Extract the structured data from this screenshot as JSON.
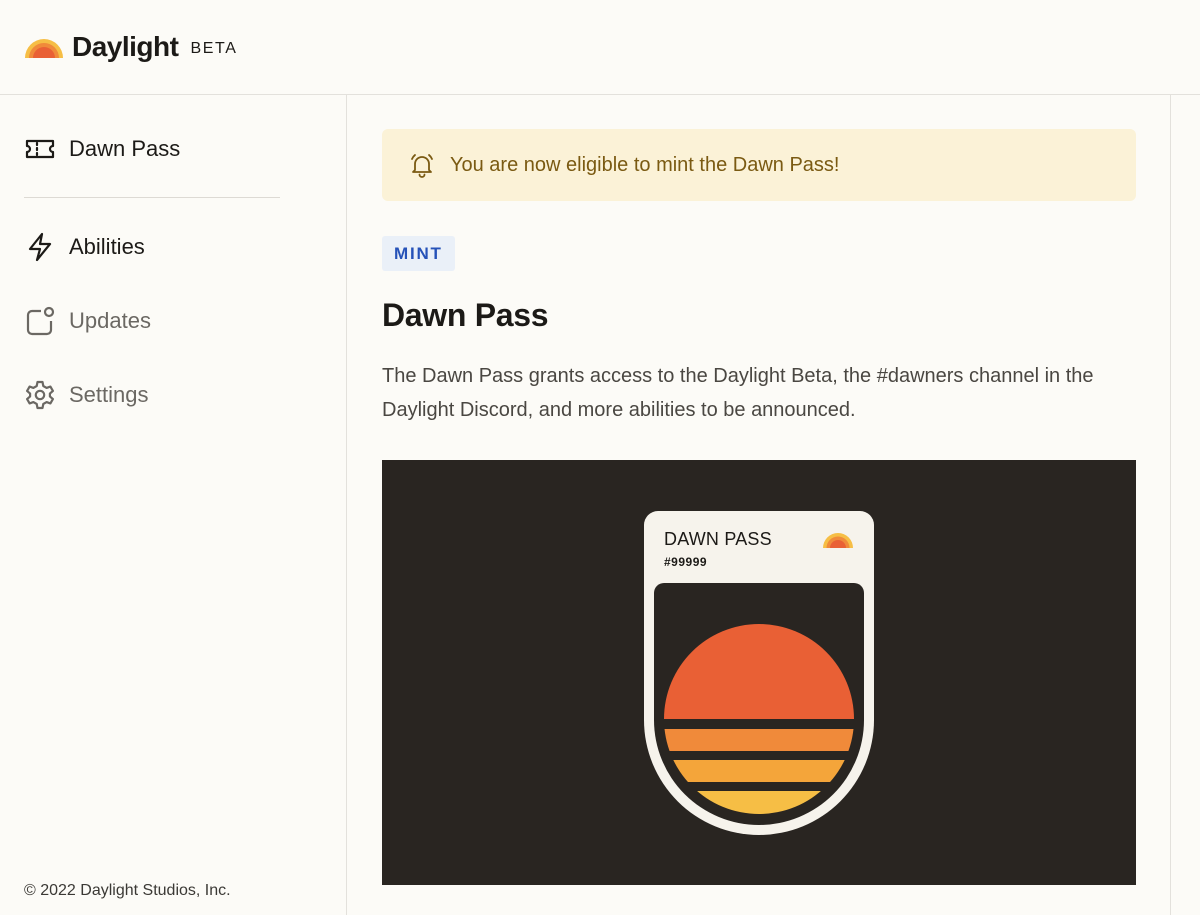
{
  "header": {
    "brand": "Daylight",
    "badge": "BETA",
    "logo_icon": "sunrise-logo-icon"
  },
  "sidebar": {
    "items": [
      {
        "label": "Dawn Pass",
        "icon": "ticket-icon",
        "state": "active"
      },
      {
        "label": "Abilities",
        "icon": "lightning-icon",
        "state": "default"
      },
      {
        "label": "Updates",
        "icon": "notification-square-icon",
        "state": "muted"
      },
      {
        "label": "Settings",
        "icon": "gear-icon",
        "state": "muted"
      }
    ],
    "footer": "© 2022 Daylight Studios, Inc."
  },
  "main": {
    "banner": {
      "text": "You are now eligible to mint the Dawn Pass!",
      "icon": "bell-icon"
    },
    "tag": "MINT",
    "title": "Dawn Pass",
    "description": "The Dawn Pass grants access to the Daylight Beta, the #dawners channel in the Daylight Discord, and more abilities to be announced.",
    "pass_card": {
      "title": "DAWN PASS",
      "number": "#99999"
    }
  },
  "colors": {
    "page_bg": "#fcfbf7",
    "banner_bg": "#fbf2d7",
    "banner_text": "#7a5a12",
    "tag_bg": "#eaf0f8",
    "tag_text": "#2652b8",
    "hero_bg": "#292521",
    "sun_top": "#e96035",
    "sun_mid": "#f08a3a",
    "sun_low": "#f4a53a",
    "sun_bottom": "#f6be45"
  }
}
